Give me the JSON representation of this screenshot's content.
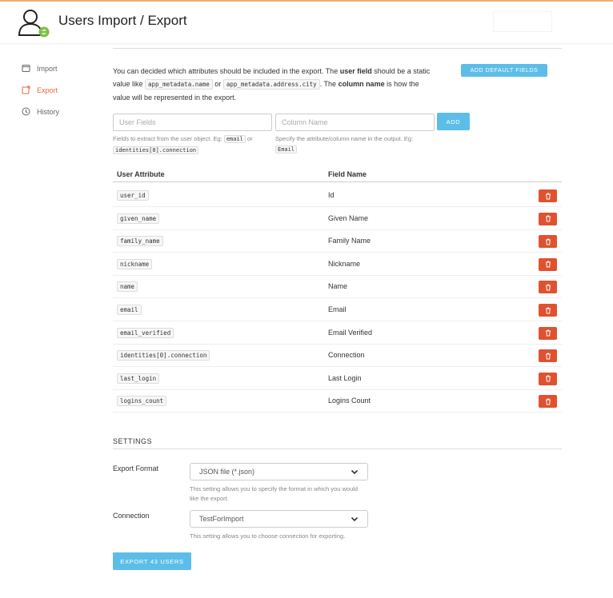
{
  "header": {
    "title": "Users Import / Export"
  },
  "sidebar": {
    "items": [
      {
        "label": "Import",
        "icon": "import-icon"
      },
      {
        "label": "Export",
        "icon": "export-icon",
        "active": true
      },
      {
        "label": "History",
        "icon": "clock-icon"
      }
    ]
  },
  "fields": {
    "intro_part1": "You can decided which attributes should be included in the export. The ",
    "intro_bold1": "user field",
    "intro_part2": " should be a static value like ",
    "intro_code1": "app_metadata.name",
    "intro_or": " or ",
    "intro_code2": "app_metadata.address.city",
    "intro_part3": ". The ",
    "intro_bold2": "column name",
    "intro_part4": " is how the value will be represented in the export.",
    "add_default_label": "ADD DEFAULT FIELDS",
    "user_fields_placeholder": "User Fields",
    "column_name_placeholder": "Column Name",
    "add_label": "ADD",
    "help1_text": "Fields to extract from the user object. Eg:",
    "help1_code1": "email",
    "help1_or": " or ",
    "help1_code2": "identities[0].connection",
    "help2_text": "Specify the attribute/column name in the output. Eg:",
    "help2_code": "Email"
  },
  "table": {
    "col_user_attribute": "User Attribute",
    "col_field_name": "Field Name",
    "rows": [
      {
        "attr": "user_id",
        "name": "Id"
      },
      {
        "attr": "given_name",
        "name": "Given Name"
      },
      {
        "attr": "family_name",
        "name": "Family Name"
      },
      {
        "attr": "nickname",
        "name": "Nickname"
      },
      {
        "attr": "name",
        "name": "Name"
      },
      {
        "attr": "email",
        "name": "Email"
      },
      {
        "attr": "email_verified",
        "name": "Email Verified"
      },
      {
        "attr": "identities[0].connection",
        "name": "Connection"
      },
      {
        "attr": "last_login",
        "name": "Last Login"
      },
      {
        "attr": "logins_count",
        "name": "Logins Count"
      }
    ]
  },
  "settings": {
    "title": "SETTINGS",
    "export_format_label": "Export Format",
    "export_format_value": "JSON file (*.json)",
    "export_format_help": "This setting allows you to specify the format in which you would like the export.",
    "connection_label": "Connection",
    "connection_value": "TestForImport",
    "connection_help": "This setting allows you to choose connection for exporting.",
    "export_button": "EXPORT 43 USERS"
  },
  "colors": {
    "accent_blue": "#5dbde9",
    "danger_red": "#e0522f",
    "active_orange": "#e66a42"
  }
}
